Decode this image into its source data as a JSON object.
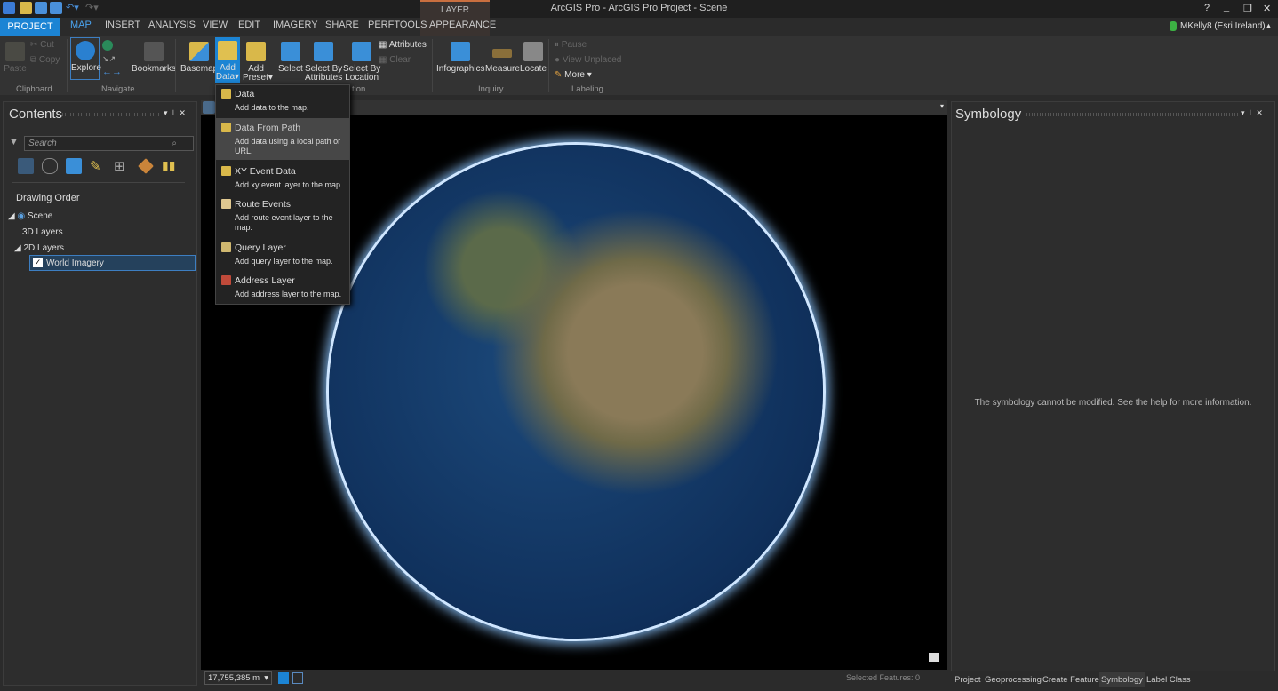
{
  "app": {
    "title": "ArcGIS Pro - ArcGIS Pro Project - Scene",
    "contextual_tab_group": "LAYER",
    "user": "MKelly8 (Esri Ireland)",
    "window_buttons": [
      "?",
      "minimize",
      "restore",
      "close"
    ]
  },
  "tabs": [
    "PROJECT",
    "MAP",
    "INSERT",
    "ANALYSIS",
    "VIEW",
    "EDIT",
    "IMAGERY",
    "SHARE",
    "PERFTOOLS",
    "APPEARANCE"
  ],
  "active_tab": "MAP",
  "ribbon": {
    "clipboard": {
      "label": "Clipboard",
      "paste": "Paste",
      "cut": "Cut",
      "copy": "Copy"
    },
    "navigate": {
      "label": "Navigate",
      "explore": "Explore",
      "bookmarks": "Bookmarks"
    },
    "layer": {
      "basemap": "Basemap",
      "add_data": [
        "Add",
        "Data"
      ],
      "add_preset": [
        "Add",
        "Preset"
      ]
    },
    "selection": {
      "label_fragment": "tion",
      "select": "Select",
      "select_by_attributes": [
        "Select By",
        "Attributes"
      ],
      "select_by_location": [
        "Select By",
        "Location"
      ],
      "attributes": "Attributes",
      "clear": "Clear"
    },
    "inquiry": {
      "label": "Inquiry",
      "infographics": "Infographics",
      "measure": "Measure",
      "locate": "Locate"
    },
    "labeling": {
      "label": "Labeling",
      "pause": "Pause",
      "view_unplaced": "View Unplaced",
      "more": "More"
    }
  },
  "add_data_menu": [
    {
      "title": "Data",
      "desc": "Add data to the map.",
      "highlighted": false
    },
    {
      "title": "Data From Path",
      "desc": "Add data using a local path or URL.",
      "highlighted": true
    },
    {
      "title": "XY Event Data",
      "desc": "Add xy event layer to the map.",
      "highlighted": false
    },
    {
      "title": "Route Events",
      "desc": "Add route event layer to the map.",
      "highlighted": false
    },
    {
      "title": "Query Layer",
      "desc": "Add query layer to the map.",
      "highlighted": false
    },
    {
      "title": "Address Layer",
      "desc": "Add address layer to the map.",
      "highlighted": false
    }
  ],
  "contents": {
    "title": "Contents",
    "search_placeholder": "Search",
    "heading": "Drawing Order",
    "tree": {
      "scene": "Scene",
      "layers3d": "3D Layers",
      "layers2d": "2D Layers",
      "world_imagery": "World Imagery"
    },
    "world_imagery_checked": true
  },
  "map": {
    "scale": "17,755,385 m",
    "selected_features": "Selected Features: 0"
  },
  "symbology": {
    "title": "Symbology",
    "message": "The symbology cannot be modified. See the help for more information."
  },
  "bottom_tabs": [
    "Project",
    "Geoprocessing",
    "Create Features",
    "Symbology",
    "Label Class"
  ],
  "active_bottom_tab": "Symbology",
  "colors": {
    "accent": "#1c84d4",
    "background": "#2b2b2b",
    "selection": "#25415c"
  }
}
